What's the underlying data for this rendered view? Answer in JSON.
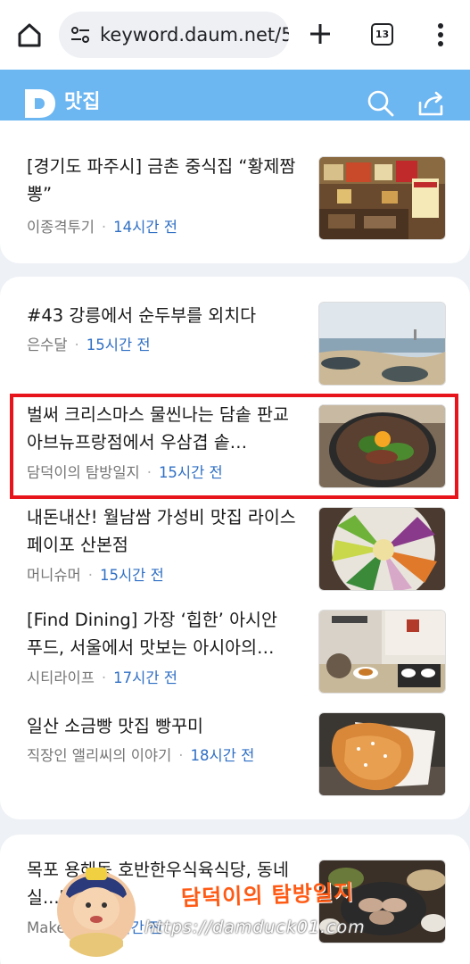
{
  "browser": {
    "url": "keyword.daum.net/5",
    "tab_count": "13"
  },
  "header": {
    "title": "맛집"
  },
  "items": [
    {
      "title": "[경기도 파주시] 금촌 중식집 “황제짬뽕”",
      "source": "이종격투기",
      "time": "14시간 전",
      "thumb": "chinese-restaurant-menu-photo"
    },
    {
      "title": "#43 강릉에서 순두부를 외치다",
      "source": "은수달",
      "time": "15시간 전",
      "thumb": "beach-sea-photo"
    },
    {
      "title": "벌써 크리스마스 물씬나는 담솥 판교아브뉴프랑점에서 우삼겹 솥…",
      "source": "담덕이의 탐방일지",
      "time": "15시간 전",
      "thumb": "beef-rice-pot-photo"
    },
    {
      "title": "내돈내산! 월남쌈 가성비 맛집 라이스페이포 산본점",
      "source": "머니슈머",
      "time": "15시간 전",
      "thumb": "vegetable-platter-photo"
    },
    {
      "title": "[Find Dining] 가장 ‘힙한’ 아시안 푸드, 서울에서 맛보는 아시아의…",
      "source": "시티라이프",
      "time": "17시간 전",
      "thumb": "asian-dishes-photo"
    },
    {
      "title": "일산 소금빵 맛집 빵꾸미",
      "source": "직장인 앨리씨의 이야기",
      "time": "18시간 전",
      "thumb": "salt-bread-photo"
    },
    {
      "title": "목포 용해동 호반한우식육식당, 동네 실...맛집 추천",
      "source": "Make...",
      "time": "18시간 전",
      "thumb": "grilled-beef-photo"
    }
  ],
  "watermark": {
    "title": "담덕이의 탐방일지",
    "url": "https://damduck01.com"
  }
}
